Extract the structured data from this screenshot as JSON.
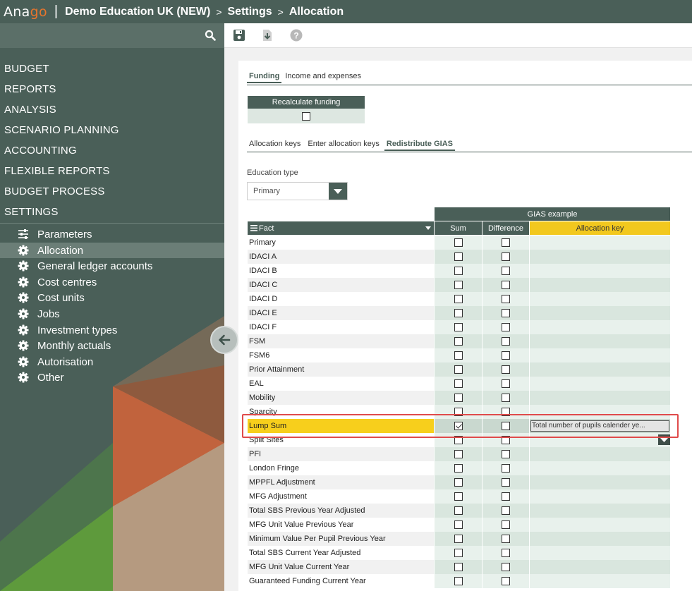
{
  "app": {
    "logo_main": "Ana",
    "logo_accent": "go",
    "separator": "|",
    "breadcrumb": [
      "Demo Education UK (NEW)",
      "Settings",
      "Allocation"
    ],
    "breadcrumb_sep": ">"
  },
  "sidebar": {
    "menu": [
      "BUDGET",
      "REPORTS",
      "ANALYSIS",
      "SCENARIO PLANNING",
      "ACCOUNTING",
      "FLEXIBLE REPORTS",
      "BUDGET PROCESS",
      "SETTINGS"
    ],
    "submenu": [
      {
        "label": "Parameters",
        "icon": "sliders-icon",
        "active": false
      },
      {
        "label": "Allocation",
        "icon": "gear-icon",
        "active": true
      },
      {
        "label": "General ledger accounts",
        "icon": "gear-icon",
        "active": false
      },
      {
        "label": "Cost centres",
        "icon": "gear-icon",
        "active": false
      },
      {
        "label": "Cost units",
        "icon": "gear-icon",
        "active": false
      },
      {
        "label": "Jobs",
        "icon": "gear-icon",
        "active": false
      },
      {
        "label": "Investment types",
        "icon": "gear-icon",
        "active": false
      },
      {
        "label": "Monthly actuals",
        "icon": "gear-icon",
        "active": false
      },
      {
        "label": "Autorisation",
        "icon": "gear-icon",
        "active": false
      },
      {
        "label": "Other",
        "icon": "gear-icon",
        "active": false
      }
    ]
  },
  "toolbar": {
    "icons": [
      "save-icon",
      "download-icon",
      "help-icon"
    ]
  },
  "tabs_main": [
    {
      "label": "Funding",
      "active": true
    },
    {
      "label": "Income and expenses",
      "active": false
    }
  ],
  "recalculate": {
    "label": "Recalculate funding",
    "checked": false
  },
  "tabs_sub": [
    {
      "label": "Allocation keys",
      "active": false
    },
    {
      "label": "Enter allocation keys",
      "active": false
    },
    {
      "label": "Redistribute GIAS",
      "active": true
    }
  ],
  "education_type": {
    "label": "Education type",
    "value": "Primary"
  },
  "grid": {
    "group_header": "GIAS example",
    "headers": {
      "fact": "Fact",
      "sum": "Sum",
      "difference": "Difference",
      "key": "Allocation key"
    },
    "rows": [
      {
        "fact": "Primary",
        "sum": false,
        "diff": false,
        "key": ""
      },
      {
        "fact": "IDACI A",
        "sum": false,
        "diff": false,
        "key": ""
      },
      {
        "fact": "IDACI B",
        "sum": false,
        "diff": false,
        "key": ""
      },
      {
        "fact": "IDACI C",
        "sum": false,
        "diff": false,
        "key": ""
      },
      {
        "fact": "IDACI D",
        "sum": false,
        "diff": false,
        "key": ""
      },
      {
        "fact": "IDACI E",
        "sum": false,
        "diff": false,
        "key": ""
      },
      {
        "fact": "IDACI F",
        "sum": false,
        "diff": false,
        "key": ""
      },
      {
        "fact": "FSM",
        "sum": false,
        "diff": false,
        "key": ""
      },
      {
        "fact": "FSM6",
        "sum": false,
        "diff": false,
        "key": ""
      },
      {
        "fact": "Prior Attainment",
        "sum": false,
        "diff": false,
        "key": ""
      },
      {
        "fact": "EAL",
        "sum": false,
        "diff": false,
        "key": ""
      },
      {
        "fact": "Mobility",
        "sum": false,
        "diff": false,
        "key": ""
      },
      {
        "fact": "Sparcity",
        "sum": false,
        "diff": false,
        "key": ""
      },
      {
        "fact": "Lump Sum",
        "sum": true,
        "diff": false,
        "key": "Total number of pupils calender ye...",
        "selected": true
      },
      {
        "fact": "Split Sites",
        "sum": false,
        "diff": false,
        "key": ""
      },
      {
        "fact": "PFI",
        "sum": false,
        "diff": false,
        "key": ""
      },
      {
        "fact": "London Fringe",
        "sum": false,
        "diff": false,
        "key": ""
      },
      {
        "fact": "MPPFL Adjustment",
        "sum": false,
        "diff": false,
        "key": ""
      },
      {
        "fact": "MFG Adjustment",
        "sum": false,
        "diff": false,
        "key": ""
      },
      {
        "fact": "Total SBS Previous Year Adjusted",
        "sum": false,
        "diff": false,
        "key": ""
      },
      {
        "fact": "MFG Unit Value Previous Year",
        "sum": false,
        "diff": false,
        "key": ""
      },
      {
        "fact": "Minimum Value Per Pupil Previous Year",
        "sum": false,
        "diff": false,
        "key": ""
      },
      {
        "fact": "Total SBS Current Year Adjusted",
        "sum": false,
        "diff": false,
        "key": ""
      },
      {
        "fact": "MFG Unit Value Current Year",
        "sum": false,
        "diff": false,
        "key": ""
      },
      {
        "fact": "Guaranteed Funding Current Year",
        "sum": false,
        "diff": false,
        "key": ""
      }
    ]
  },
  "colors": {
    "brand_dark": "#4a5f58",
    "accent_orange": "#e8752c",
    "highlight_yellow": "#f7cf1c",
    "annotation_red": "#e04b4b"
  }
}
